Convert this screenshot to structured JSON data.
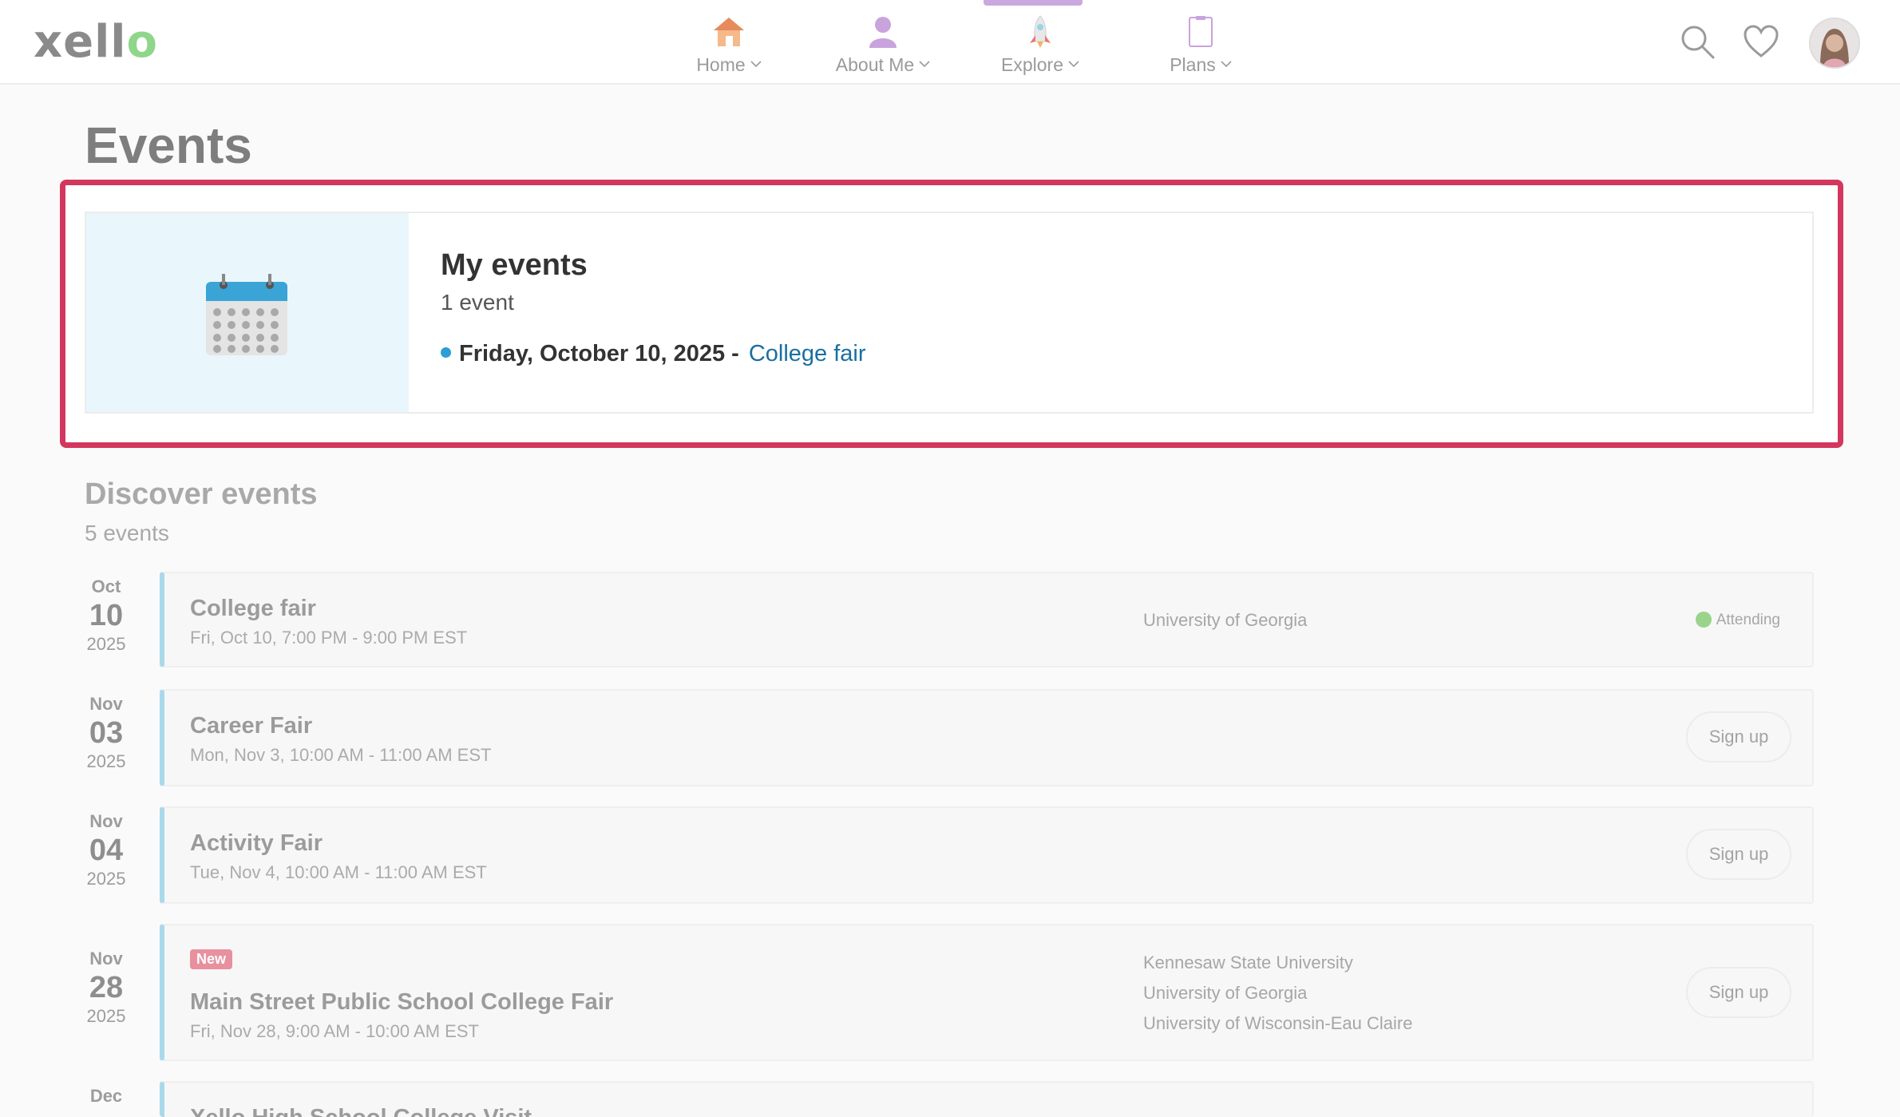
{
  "header": {
    "logo": "xell",
    "logo_dot": "o",
    "nav": [
      {
        "label": "Home",
        "icon": "house-icon"
      },
      {
        "label": "About Me",
        "icon": "person-icon"
      },
      {
        "label": "Explore",
        "icon": "rocket-icon"
      },
      {
        "label": "Plans",
        "icon": "clipboard-icon"
      }
    ],
    "active_nav": "Explore",
    "icons": [
      "search-icon",
      "heart-icon",
      "avatar"
    ]
  },
  "page": {
    "title": "Events"
  },
  "my_events": {
    "title": "My events",
    "count": "1 event",
    "date": "Friday, October 10, 2025 -",
    "event_link": "College fair"
  },
  "discover": {
    "title": "Discover events",
    "count": "5 events",
    "events": [
      {
        "month": "Oct",
        "day": "10",
        "year": "2025",
        "name": "College fair",
        "time": "Fri, Oct 10, 7:00 PM - 9:00 PM EST",
        "orgs": [
          "University of Georgia"
        ],
        "status": "Attending"
      },
      {
        "month": "Nov",
        "day": "03",
        "year": "2025",
        "name": "Career Fair",
        "time": "Mon, Nov 3, 10:00 AM - 11:00 AM EST",
        "action": "Sign up"
      },
      {
        "month": "Nov",
        "day": "04",
        "year": "2025",
        "name": "Activity Fair",
        "time": "Tue, Nov 4, 10:00 AM - 11:00 AM EST",
        "action": "Sign up"
      },
      {
        "month": "Nov",
        "day": "28",
        "year": "2025",
        "badge": "New",
        "name": "Main Street Public School College Fair",
        "time": "Fri, Nov 28, 9:00 AM - 10:00 AM EST",
        "orgs": [
          "Kennesaw State University",
          "University of Georgia",
          "University of Wisconsin-Eau Claire"
        ],
        "action": "Sign up"
      },
      {
        "month": "Dec",
        "name": "Xello High School College Visit"
      }
    ]
  },
  "colors": {
    "highlight": "#d3375d",
    "link": "#1a6fa0",
    "accent_bar": "#aad9ec",
    "nav_active": "#c9a9df"
  }
}
